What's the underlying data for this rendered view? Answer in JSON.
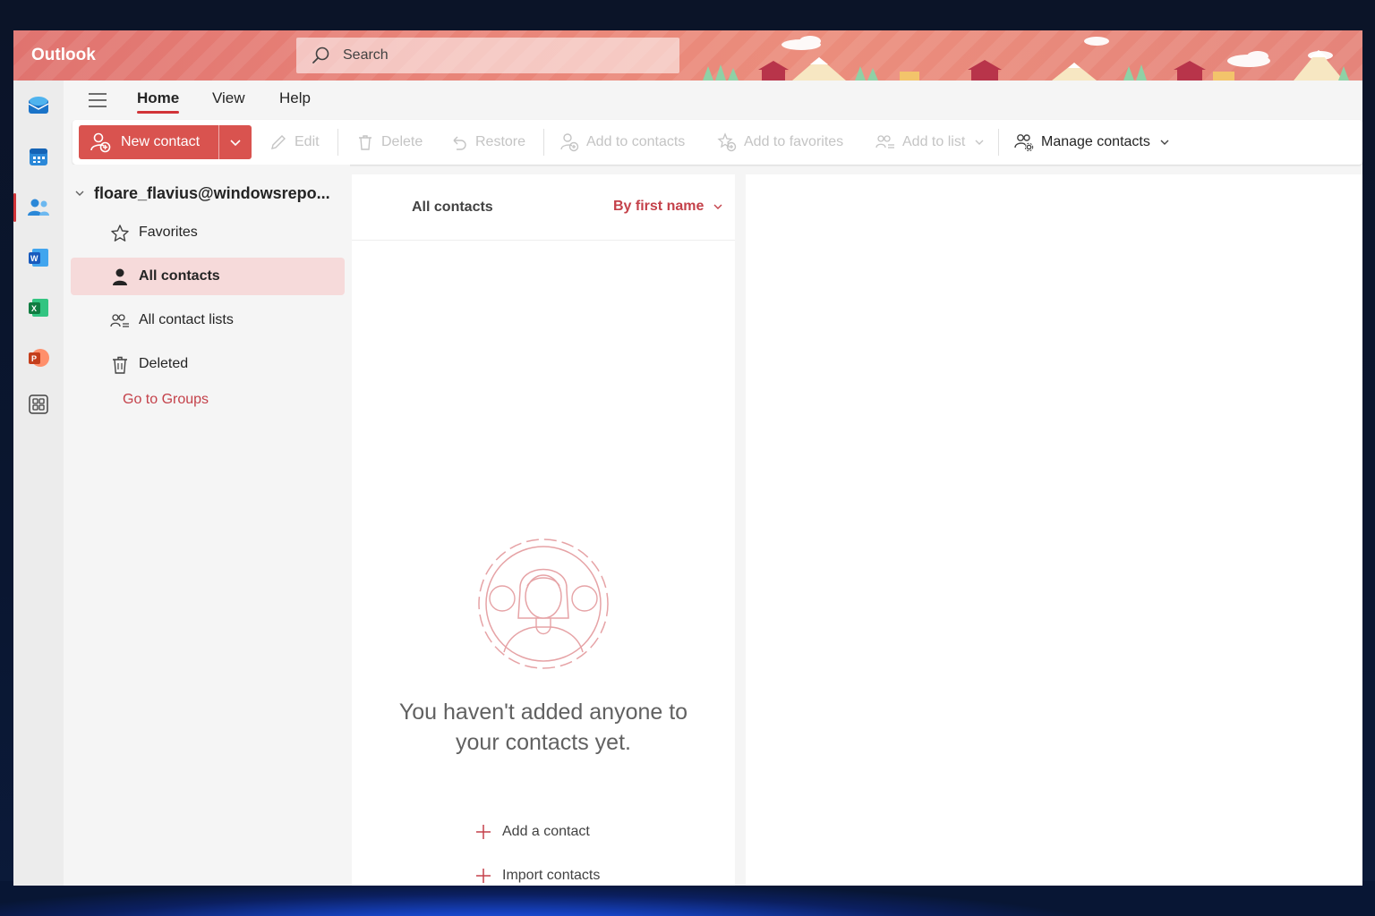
{
  "app": {
    "title": "Outlook"
  },
  "search": {
    "placeholder": "Search"
  },
  "tabs": [
    {
      "label": "Home",
      "active": true
    },
    {
      "label": "View",
      "active": false
    },
    {
      "label": "Help",
      "active": false
    }
  ],
  "rail": [
    "mail-icon",
    "calendar-icon",
    "people-icon",
    "word-icon",
    "excel-icon",
    "powerpoint-icon",
    "apps-icon"
  ],
  "toolbar": {
    "new_contact": "New contact",
    "edit": "Edit",
    "delete": "Delete",
    "restore": "Restore",
    "add_to_contacts": "Add to contacts",
    "add_to_favorites": "Add to favorites",
    "add_to_list": "Add to list",
    "manage_contacts": "Manage contacts"
  },
  "folders": {
    "account": "floare_flavius@windowsrepo...",
    "items": [
      {
        "label": "Favorites",
        "icon": "star-icon"
      },
      {
        "label": "All contacts",
        "icon": "person-icon",
        "selected": true
      },
      {
        "label": "All contact lists",
        "icon": "contact-list-icon"
      },
      {
        "label": "Deleted",
        "icon": "trash-icon"
      }
    ],
    "groups_link": "Go to Groups"
  },
  "list": {
    "title": "All contacts",
    "sort": "By first name",
    "empty_line1": "You haven't added anyone to",
    "empty_line2": "your contacts yet.",
    "add_contact": "Add a contact",
    "import_contacts": "Import contacts"
  },
  "colors": {
    "accent": "#d13438",
    "primary_button": "#d9534f",
    "link": "#c4414a",
    "selected_bg": "#f6dada"
  }
}
